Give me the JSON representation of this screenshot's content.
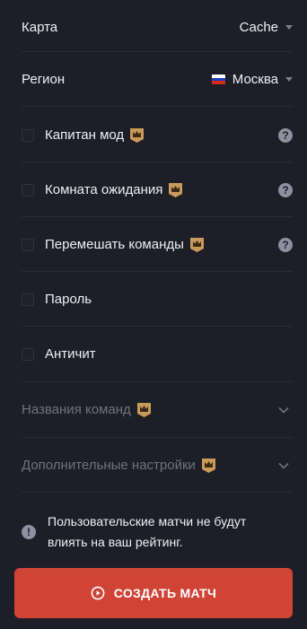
{
  "map": {
    "label": "Карта",
    "value": "Cache"
  },
  "region": {
    "label": "Регион",
    "value": "Москва",
    "flag_colors": [
      "#ffffff",
      "#1c3fb5",
      "#d52b1e"
    ]
  },
  "options": [
    {
      "label": "Капитан мод",
      "premium": true,
      "help": "?"
    },
    {
      "label": "Комната ожидания",
      "premium": true,
      "help": "?"
    },
    {
      "label": "Перемешать команды",
      "premium": true,
      "help": "?"
    },
    {
      "label": "Пароль",
      "premium": false
    },
    {
      "label": "Античит",
      "premium": false
    }
  ],
  "sections": [
    {
      "label": "Названия команд",
      "premium": true
    },
    {
      "label": "Дополнительные настройки",
      "premium": true
    }
  ],
  "notice": {
    "icon": "!",
    "line1": "Пользовательские матчи не будут",
    "line2": "влиять на ваш рейтинг."
  },
  "create_button": {
    "label": "СОЗДАТЬ МАТЧ"
  },
  "colors": {
    "background": "#1d1e27",
    "accent": "#d04436",
    "crown": "#c99a5b"
  }
}
